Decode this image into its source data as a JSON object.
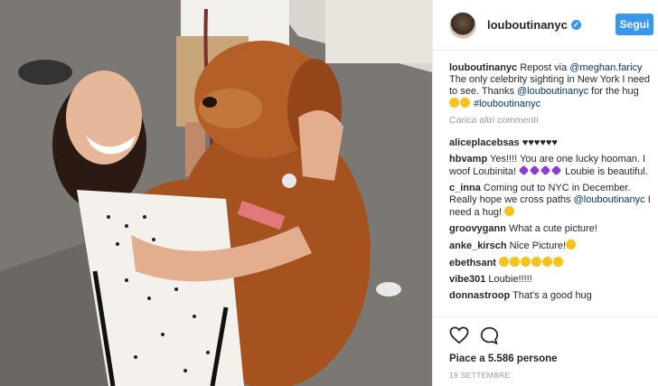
{
  "post": {
    "username": "louboutinanyc",
    "verified_icon": "verified-badge-icon",
    "follow_label": "Segui",
    "accent": "#3897f0"
  },
  "caption": {
    "user": "louboutinanyc",
    "text_1": " Repost via ",
    "mention_1": "@meghan.faricy",
    "text_2": " The only celebrity sighting in New York I need to see. Thanks ",
    "mention_2": "@louboutinanyc",
    "text_3": " for the hug ",
    "hashtag": "#louboutinanyc"
  },
  "load_more": "Carica altri commenti",
  "comments": [
    {
      "user": "aliceplacebsas",
      "text": " ♥♥♥♥♥♥"
    },
    {
      "user": "hbvamp",
      "text_1": " Yes!!!! You are one lucky hooman. I woof Loubinita! ",
      "text_2": " Loubie is beautiful."
    },
    {
      "user": "c_inna",
      "text_1": " Coming out to NYC in December. Really hope we cross paths ",
      "mention": "@louboutinanyc",
      "text_2": " I need a hug! "
    },
    {
      "user": "groovygann",
      "text": " What a cute picture!"
    },
    {
      "user": "anke_kirsch",
      "text": " Nice Picture!"
    },
    {
      "user": "ebethsant",
      "text": " "
    },
    {
      "user": "vibe301",
      "text": " Loubie!!!!!"
    },
    {
      "user": "donnastroop",
      "text": " That's a good hug"
    }
  ],
  "actions": {
    "like_icon": "heart-outline-icon",
    "comment_icon": "comment-bubble-icon",
    "likes_text": "Piace a 5.586 persone",
    "date": "19 SETTEMBRE"
  }
}
